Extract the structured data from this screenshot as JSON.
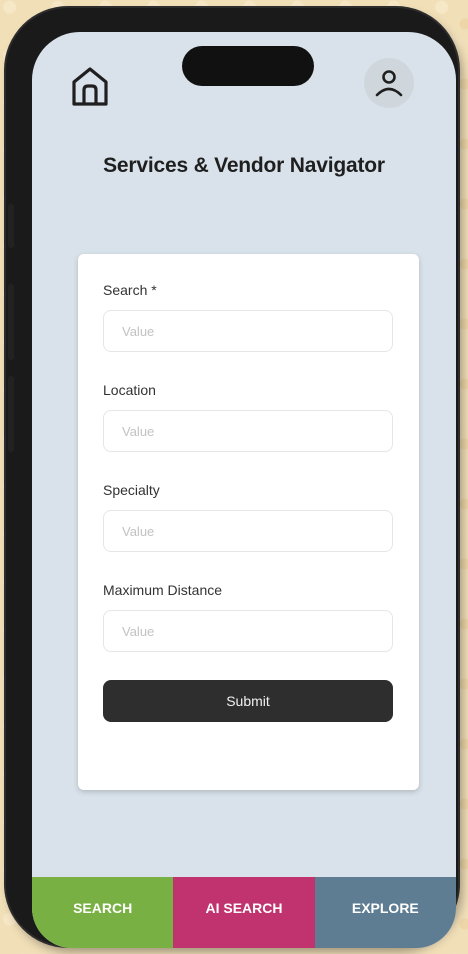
{
  "header": {
    "title": "Services & Vendor Navigator",
    "home_icon": "home-icon",
    "profile_icon": "user-icon"
  },
  "form": {
    "fields": [
      {
        "label": "Search *",
        "placeholder": "Value",
        "value": ""
      },
      {
        "label": "Location",
        "placeholder": "Value",
        "value": ""
      },
      {
        "label": "Specialty",
        "placeholder": "Value",
        "value": ""
      },
      {
        "label": "Maximum Distance",
        "placeholder": "Value",
        "value": ""
      }
    ],
    "submit_label": "Submit"
  },
  "nav": {
    "tabs": [
      {
        "label": "SEARCH",
        "color": "#79b043"
      },
      {
        "label": "AI SEARCH",
        "color": "#c1336e"
      },
      {
        "label": "EXPLORE",
        "color": "#5e7c92"
      }
    ]
  },
  "colors": {
    "screen_bg": "#d9e2ea",
    "button_bg": "#2e2e2e",
    "page_bg": "#f1dfb8"
  }
}
